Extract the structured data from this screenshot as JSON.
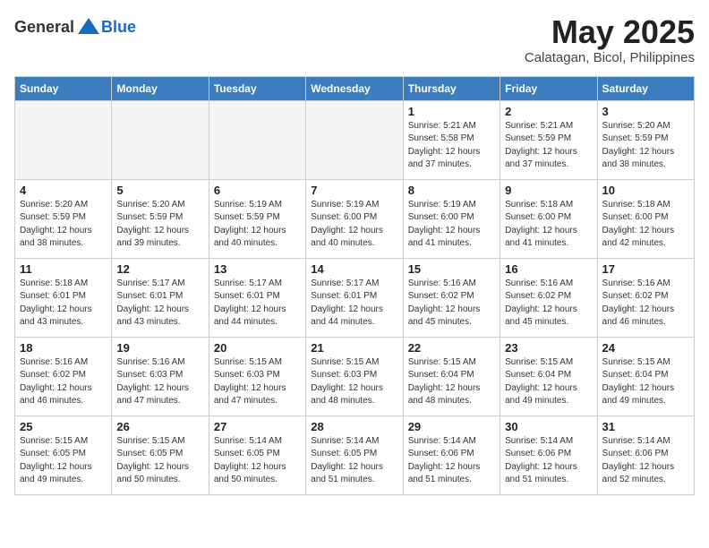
{
  "logo": {
    "general": "General",
    "blue": "Blue"
  },
  "title": {
    "month": "May 2025",
    "location": "Calatagan, Bicol, Philippines"
  },
  "days_of_week": [
    "Sunday",
    "Monday",
    "Tuesday",
    "Wednesday",
    "Thursday",
    "Friday",
    "Saturday"
  ],
  "weeks": [
    [
      {
        "day": "",
        "info": ""
      },
      {
        "day": "",
        "info": ""
      },
      {
        "day": "",
        "info": ""
      },
      {
        "day": "",
        "info": ""
      },
      {
        "day": "1",
        "info": "Sunrise: 5:21 AM\nSunset: 5:58 PM\nDaylight: 12 hours\nand 37 minutes."
      },
      {
        "day": "2",
        "info": "Sunrise: 5:21 AM\nSunset: 5:59 PM\nDaylight: 12 hours\nand 37 minutes."
      },
      {
        "day": "3",
        "info": "Sunrise: 5:20 AM\nSunset: 5:59 PM\nDaylight: 12 hours\nand 38 minutes."
      }
    ],
    [
      {
        "day": "4",
        "info": "Sunrise: 5:20 AM\nSunset: 5:59 PM\nDaylight: 12 hours\nand 38 minutes."
      },
      {
        "day": "5",
        "info": "Sunrise: 5:20 AM\nSunset: 5:59 PM\nDaylight: 12 hours\nand 39 minutes."
      },
      {
        "day": "6",
        "info": "Sunrise: 5:19 AM\nSunset: 5:59 PM\nDaylight: 12 hours\nand 40 minutes."
      },
      {
        "day": "7",
        "info": "Sunrise: 5:19 AM\nSunset: 6:00 PM\nDaylight: 12 hours\nand 40 minutes."
      },
      {
        "day": "8",
        "info": "Sunrise: 5:19 AM\nSunset: 6:00 PM\nDaylight: 12 hours\nand 41 minutes."
      },
      {
        "day": "9",
        "info": "Sunrise: 5:18 AM\nSunset: 6:00 PM\nDaylight: 12 hours\nand 41 minutes."
      },
      {
        "day": "10",
        "info": "Sunrise: 5:18 AM\nSunset: 6:00 PM\nDaylight: 12 hours\nand 42 minutes."
      }
    ],
    [
      {
        "day": "11",
        "info": "Sunrise: 5:18 AM\nSunset: 6:01 PM\nDaylight: 12 hours\nand 43 minutes."
      },
      {
        "day": "12",
        "info": "Sunrise: 5:17 AM\nSunset: 6:01 PM\nDaylight: 12 hours\nand 43 minutes."
      },
      {
        "day": "13",
        "info": "Sunrise: 5:17 AM\nSunset: 6:01 PM\nDaylight: 12 hours\nand 44 minutes."
      },
      {
        "day": "14",
        "info": "Sunrise: 5:17 AM\nSunset: 6:01 PM\nDaylight: 12 hours\nand 44 minutes."
      },
      {
        "day": "15",
        "info": "Sunrise: 5:16 AM\nSunset: 6:02 PM\nDaylight: 12 hours\nand 45 minutes."
      },
      {
        "day": "16",
        "info": "Sunrise: 5:16 AM\nSunset: 6:02 PM\nDaylight: 12 hours\nand 45 minutes."
      },
      {
        "day": "17",
        "info": "Sunrise: 5:16 AM\nSunset: 6:02 PM\nDaylight: 12 hours\nand 46 minutes."
      }
    ],
    [
      {
        "day": "18",
        "info": "Sunrise: 5:16 AM\nSunset: 6:02 PM\nDaylight: 12 hours\nand 46 minutes."
      },
      {
        "day": "19",
        "info": "Sunrise: 5:16 AM\nSunset: 6:03 PM\nDaylight: 12 hours\nand 47 minutes."
      },
      {
        "day": "20",
        "info": "Sunrise: 5:15 AM\nSunset: 6:03 PM\nDaylight: 12 hours\nand 47 minutes."
      },
      {
        "day": "21",
        "info": "Sunrise: 5:15 AM\nSunset: 6:03 PM\nDaylight: 12 hours\nand 48 minutes."
      },
      {
        "day": "22",
        "info": "Sunrise: 5:15 AM\nSunset: 6:04 PM\nDaylight: 12 hours\nand 48 minutes."
      },
      {
        "day": "23",
        "info": "Sunrise: 5:15 AM\nSunset: 6:04 PM\nDaylight: 12 hours\nand 49 minutes."
      },
      {
        "day": "24",
        "info": "Sunrise: 5:15 AM\nSunset: 6:04 PM\nDaylight: 12 hours\nand 49 minutes."
      }
    ],
    [
      {
        "day": "25",
        "info": "Sunrise: 5:15 AM\nSunset: 6:05 PM\nDaylight: 12 hours\nand 49 minutes."
      },
      {
        "day": "26",
        "info": "Sunrise: 5:15 AM\nSunset: 6:05 PM\nDaylight: 12 hours\nand 50 minutes."
      },
      {
        "day": "27",
        "info": "Sunrise: 5:14 AM\nSunset: 6:05 PM\nDaylight: 12 hours\nand 50 minutes."
      },
      {
        "day": "28",
        "info": "Sunrise: 5:14 AM\nSunset: 6:05 PM\nDaylight: 12 hours\nand 51 minutes."
      },
      {
        "day": "29",
        "info": "Sunrise: 5:14 AM\nSunset: 6:06 PM\nDaylight: 12 hours\nand 51 minutes."
      },
      {
        "day": "30",
        "info": "Sunrise: 5:14 AM\nSunset: 6:06 PM\nDaylight: 12 hours\nand 51 minutes."
      },
      {
        "day": "31",
        "info": "Sunrise: 5:14 AM\nSunset: 6:06 PM\nDaylight: 12 hours\nand 52 minutes."
      }
    ]
  ]
}
